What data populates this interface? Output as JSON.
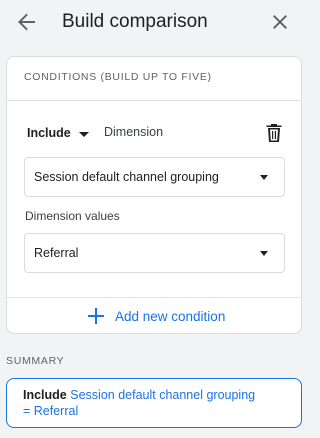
{
  "header": {
    "title": "Build comparison",
    "back_icon": "arrow-back-icon",
    "close_icon": "close-icon"
  },
  "conditions": {
    "heading": "CONDITIONS (BUILD UP TO FIVE)",
    "include_label": "Include",
    "dimension_label": "Dimension",
    "delete_icon": "trash-icon",
    "dimension_select_value": "Session default channel grouping",
    "dimension_values_label": "Dimension values",
    "dimension_values_select_value": "Referral",
    "add_condition_label": "Add new condition",
    "add_icon": "plus-icon"
  },
  "summary": {
    "heading": "SUMMARY",
    "include": "Include",
    "dimension": "Session default channel grouping",
    "equals_value": "= Referral"
  },
  "colors": {
    "accent": "#1a73e8",
    "background": "#f1f3f4",
    "card": "#ffffff",
    "border": "#dadce0"
  }
}
